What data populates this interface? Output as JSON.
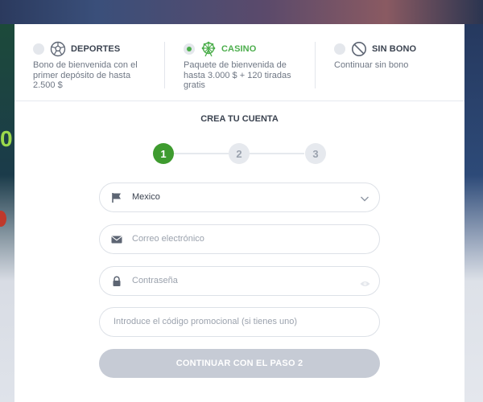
{
  "bonus_options": [
    {
      "title": "DEPORTES",
      "desc_lines": [
        "Bono de bienvenida con el",
        "primer depósito de hasta",
        "2.500 $"
      ],
      "icon": "soccer-ball-icon",
      "selected": false
    },
    {
      "title": "CASINO",
      "desc_lines": [
        "Paquete de bienvenida de",
        "hasta 3.000 $ + 120 tiradas",
        "gratis"
      ],
      "icon": "ferris-wheel-icon",
      "selected": true
    },
    {
      "title": "SIN BONO",
      "desc_lines": [
        "Continuar sin bono"
      ],
      "icon": "no-entry-icon",
      "selected": false
    }
  ],
  "form": {
    "heading": "CREA TU CUENTA",
    "steps": [
      "1",
      "2",
      "3"
    ],
    "active_step": 1,
    "country": {
      "value": "Mexico",
      "icon": "flag-icon"
    },
    "email": {
      "placeholder": "Correo electrónico",
      "icon": "envelope-icon"
    },
    "password": {
      "placeholder": "Contraseña",
      "icon": "lock-icon"
    },
    "promo": {
      "placeholder": "Introduce el código promocional (si tienes uno)"
    },
    "continue_label": "CONTINUAR CON EL PASO 2"
  },
  "background": {
    "left_digit": "0"
  },
  "colors": {
    "accent": "#4cae4c",
    "step_active": "#3e9b2f",
    "button_disabled": "#c6cbd5"
  }
}
